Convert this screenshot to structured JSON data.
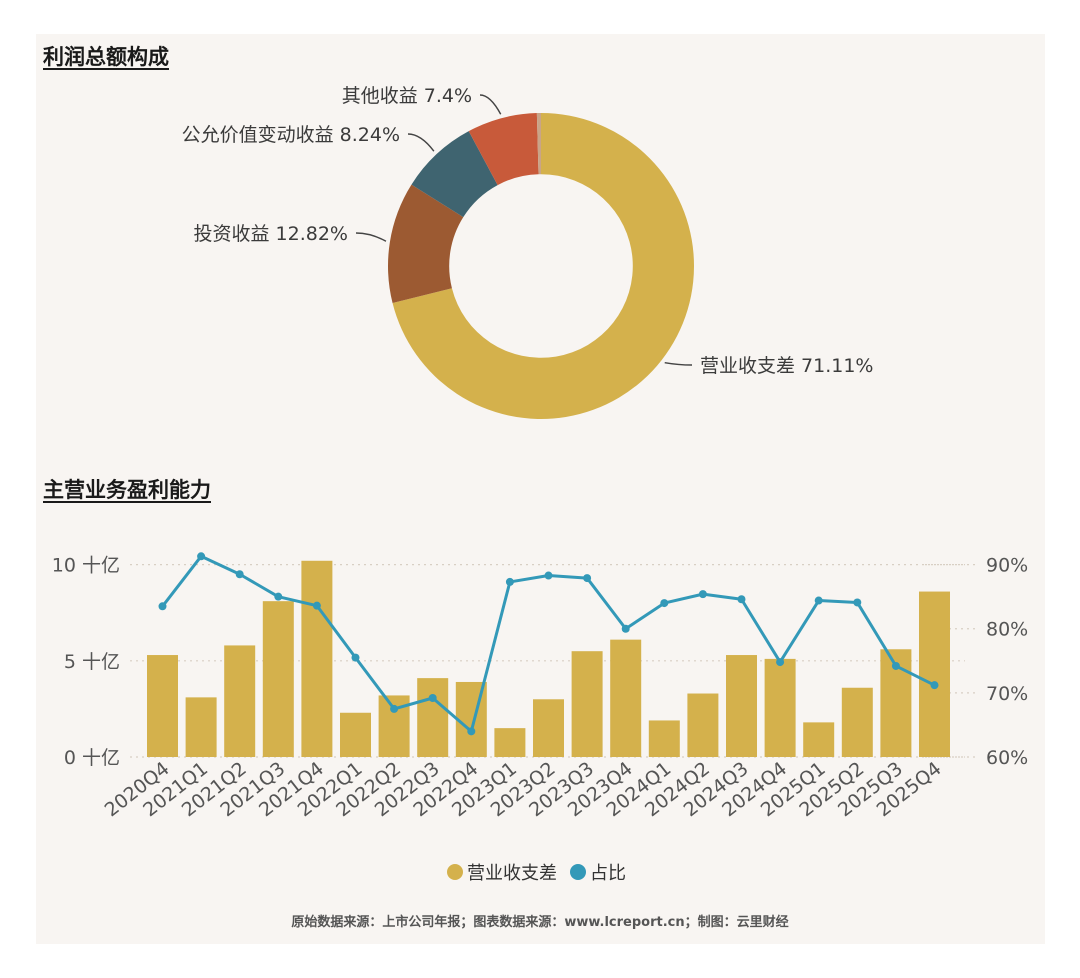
{
  "colors": {
    "panel_bg": "#f8f5f2",
    "revenue": "#d4b14c",
    "investment": "#9c5a32",
    "fair_value": "#3f6470",
    "other": "#c85a3a",
    "misc": "#c9a488",
    "ratio_line": "#3399b8",
    "grid": "#d8cfc4"
  },
  "footer": "原始数据来源：上市公司年报；图表数据来源：www.lcreport.cn；制图：云里财经",
  "chart_data": [
    {
      "type": "pie",
      "title": "利润总额构成",
      "hole": 0.6,
      "slices": [
        {
          "name": "营业收支差",
          "value": 71.11,
          "display": "营业收支差 71.11%"
        },
        {
          "name": "投资收益",
          "value": 12.82,
          "display": "投资收益 12.82%"
        },
        {
          "name": "公允价值变动收益",
          "value": 8.24,
          "display": "公允价值变动收益 8.24%"
        },
        {
          "name": "其他收益",
          "value": 7.4,
          "display": "其他收益 7.4%"
        },
        {
          "name": "",
          "value": 0.43,
          "display": ""
        }
      ]
    },
    {
      "type": "bar",
      "title": "主营业务盈利能力",
      "categories": [
        "2020Q4",
        "2021Q1",
        "2021Q2",
        "2021Q3",
        "2021Q4",
        "2022Q1",
        "2022Q2",
        "2022Q3",
        "2022Q4",
        "2023Q1",
        "2023Q2",
        "2023Q3",
        "2023Q4",
        "2024Q1",
        "2024Q2",
        "2024Q3",
        "2024Q4",
        "2025Q1",
        "2025Q2",
        "2025Q3",
        "2025Q4"
      ],
      "series": [
        {
          "name": "营业收支差",
          "type": "bar",
          "axis": "left",
          "values": [
            5.3,
            3.1,
            5.8,
            8.1,
            10.2,
            2.3,
            3.2,
            4.1,
            3.9,
            1.5,
            3.0,
            5.5,
            6.1,
            1.9,
            3.3,
            5.3,
            5.1,
            1.8,
            3.6,
            5.6,
            8.6
          ]
        },
        {
          "name": "占比",
          "type": "line",
          "axis": "right",
          "values": [
            83.5,
            91.3,
            88.5,
            85.0,
            83.6,
            75.5,
            67.5,
            69.2,
            64.0,
            87.3,
            88.3,
            87.9,
            80.0,
            84.0,
            85.4,
            84.6,
            74.8,
            84.4,
            84.1,
            74.2,
            71.2
          ]
        }
      ],
      "y_left": {
        "ylim": [
          0,
          10.5
        ],
        "ticks": [
          0,
          5,
          10
        ],
        "tick_labels": [
          "0 十亿",
          "5 十亿",
          "10 十亿"
        ]
      },
      "y_right": {
        "ylim": [
          60,
          91.5
        ],
        "ticks": [
          60,
          70,
          80,
          90
        ],
        "tick_labels": [
          "60%",
          "70%",
          "80%",
          "90%"
        ]
      },
      "grid": true,
      "legend": "bottom-center"
    }
  ]
}
